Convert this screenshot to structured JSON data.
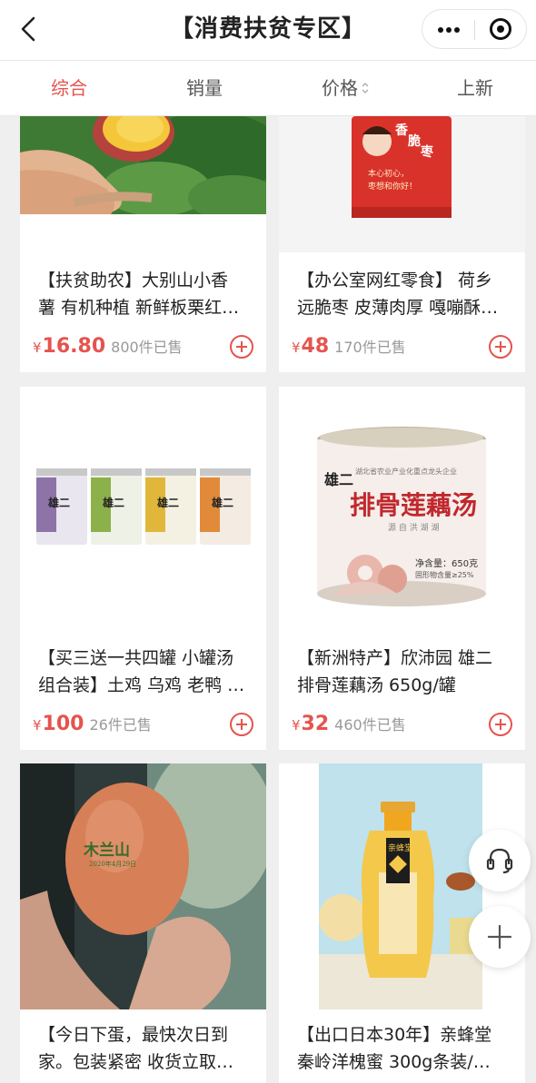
{
  "header": {
    "title": "【消费扶贫专区】"
  },
  "sort_tabs": [
    {
      "label": "综合",
      "active": true
    },
    {
      "label": "销量",
      "active": false
    },
    {
      "label": "价格",
      "active": false
    },
    {
      "label": "上新",
      "active": false
    }
  ],
  "products": [
    {
      "line1": "【扶贫助农】大别山小香",
      "line2": "薯 有机种植 新鲜板栗红…",
      "currency": "¥",
      "price": "16.80",
      "sold": "800件已售"
    },
    {
      "line1": "【办公室网红零食】 荷乡",
      "line2": "远脆枣 皮薄肉厚 嘎嘣酥…",
      "currency": "¥",
      "price": "48",
      "sold": "170件已售",
      "package_text": [
        "香",
        "脆",
        "枣",
        "本心初心，",
        "枣想和你好！"
      ]
    },
    {
      "line1": "【买三送一共四罐 小罐汤",
      "line2": "组合装】土鸡 乌鸡 老鸭 …",
      "currency": "¥",
      "price": "100",
      "sold": "26件已售",
      "can_label": "雄二"
    },
    {
      "line1": "【新洲特产】欣沛园 雄二",
      "line2": "排骨莲藕汤 650g/罐",
      "currency": "¥",
      "price": "32",
      "sold": "460件已售",
      "can_text": {
        "top": "湖北省农业产业化重点龙头企业",
        "brand": "雄二",
        "name": "排骨莲藕汤",
        "sub": "源 自 洪 湖 湖",
        "weight": "净含量：650克",
        "note": "固形物含量≥25%"
      }
    },
    {
      "line1": "【今日下蛋，最快次日到",
      "line2": "家。包装紧密 收货立取…",
      "currency": "¥",
      "price": "",
      "sold": "",
      "egg_stamp": {
        "brand": "木兰山",
        "date": "2020年4月29日"
      }
    },
    {
      "line1": "【出口日本30年】亲蜂堂",
      "line2": "秦岭洋槐蜜 300g条装/…",
      "currency": "¥",
      "price": "",
      "sold": "",
      "jar_label": "亲蜂堂"
    }
  ],
  "colors": {
    "accent": "#e5544e",
    "background": "#efefef"
  },
  "icons": {
    "back": "chevron-left-icon",
    "more": "more-dots-icon",
    "close": "close-circle-icon",
    "service": "headset-icon",
    "add": "plus-icon"
  }
}
